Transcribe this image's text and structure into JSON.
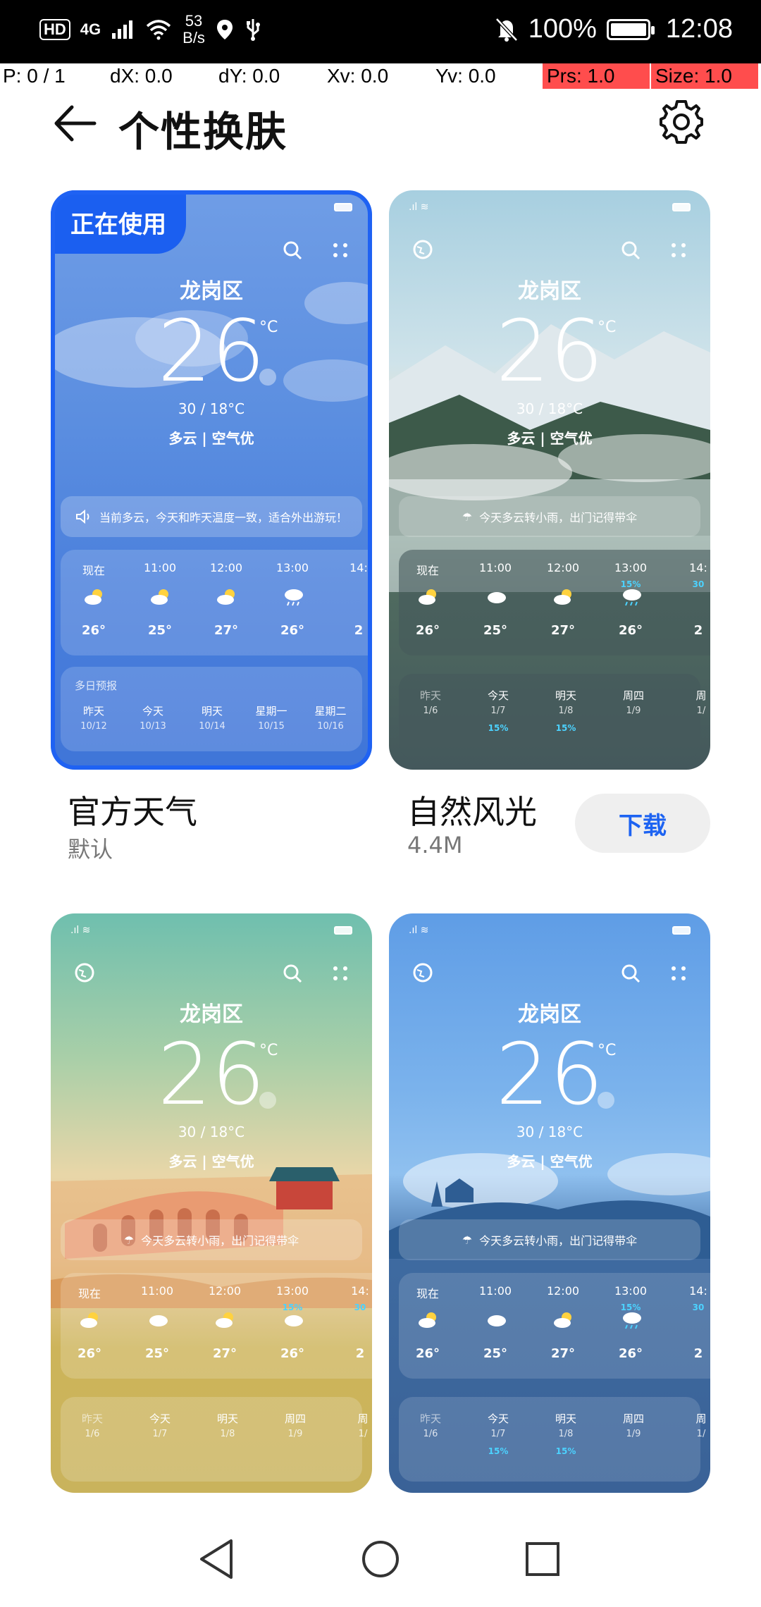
{
  "status_bar": {
    "hd": "HD",
    "network": "4G",
    "speed_value": "53",
    "speed_unit": "B/s",
    "battery": "100%",
    "time": "12:08",
    "icons": [
      "signal-icon",
      "wifi-icon",
      "location-icon",
      "usb-icon",
      "mute-icon",
      "battery-icon"
    ]
  },
  "pointer_info": {
    "p": "P: 0 / 1",
    "dx": "dX: 0.0",
    "dy": "dY: 0.0",
    "xv": "Xv: 0.0",
    "yv": "Yv: 0.0",
    "prs": "Prs: 1.0",
    "size": "Size: 1.0"
  },
  "header": {
    "title": "个性换肤",
    "back_icon": "arrow-left-icon",
    "settings_icon": "gear-icon"
  },
  "themes": [
    {
      "name": "官方天气",
      "meta": "默认",
      "badge": "正在使用",
      "selected": true,
      "colors": {
        "top": "#5b8ee0",
        "bottom": "#3f75d8"
      },
      "preview": {
        "city": "龙岗区",
        "temp": "26",
        "unit": "°C",
        "range": "30 / 18°C",
        "cond": "多云 | 空气优",
        "notice": "当前多云，今天和昨天温度一致，适合外出游玩！",
        "hours": [
          {
            "h": "现在",
            "t": "26°"
          },
          {
            "h": "11:00",
            "t": "25°"
          },
          {
            "h": "12:00",
            "t": "27°"
          },
          {
            "h": "13:00",
            "t": "26°"
          },
          {
            "h": "14:",
            "t": "2"
          }
        ],
        "daily_label": "多日预报",
        "days": [
          {
            "d": "昨天",
            "date": "10/12"
          },
          {
            "d": "今天",
            "date": "10/13"
          },
          {
            "d": "明天",
            "date": "10/14"
          },
          {
            "d": "星期一",
            "date": "10/15"
          },
          {
            "d": "星期二",
            "date": "10/16"
          }
        ]
      }
    },
    {
      "name": "自然风光",
      "meta": "4.4M",
      "action": "下载",
      "selected": false,
      "colors": {
        "top": "#9fc8d8",
        "bottom": "#4a5c5e"
      },
      "preview": {
        "city": "龙岗区",
        "temp": "26",
        "unit": "°C",
        "range": "30 / 18°C",
        "cond": "多云 | 空气优",
        "notice": "今天多云转小雨，出门记得带伞",
        "hours": [
          {
            "h": "现在",
            "t": "26°"
          },
          {
            "h": "11:00",
            "t": "25°"
          },
          {
            "h": "12:00",
            "t": "27°"
          },
          {
            "h": "13:00",
            "t": "26°",
            "p": "15%"
          },
          {
            "h": "14:",
            "t": "2",
            "p": "30"
          }
        ],
        "days": [
          {
            "d": "昨天",
            "date": "1/6"
          },
          {
            "d": "今天",
            "date": "1/7",
            "p": "15%"
          },
          {
            "d": "明天",
            "date": "1/8",
            "p": "15%"
          },
          {
            "d": "周四",
            "date": "1/9"
          },
          {
            "d": "周",
            "date": "1/"
          }
        ]
      }
    },
    {
      "name": "",
      "colors": {
        "top": "#7cc1ad",
        "bottom": "#cdb45a"
      },
      "preview": {
        "city": "龙岗区",
        "temp": "26",
        "unit": "°C",
        "range": "30 / 18°C",
        "cond": "多云 | 空气优",
        "notice": "今天多云转小雨，出门记得带伞",
        "hours": [
          {
            "h": "现在",
            "t": "26°"
          },
          {
            "h": "11:00",
            "t": "25°"
          },
          {
            "h": "12:00",
            "t": "27°"
          },
          {
            "h": "13:00",
            "t": "26°",
            "p": "15%"
          },
          {
            "h": "14:",
            "t": "2",
            "p": "30"
          }
        ],
        "days": [
          {
            "d": "昨天",
            "date": "1/6"
          },
          {
            "d": "今天",
            "date": "1/7"
          },
          {
            "d": "明天",
            "date": "1/8"
          },
          {
            "d": "周四",
            "date": "1/9"
          },
          {
            "d": "周",
            "date": "1/"
          }
        ]
      }
    },
    {
      "name": "",
      "colors": {
        "top": "#6fa7e6",
        "bottom": "#3e6aa0"
      },
      "preview": {
        "city": "龙岗区",
        "temp": "26",
        "unit": "°C",
        "range": "30 / 18°C",
        "cond": "多云 | 空气优",
        "notice": "今天多云转小雨，出门记得带伞",
        "hours": [
          {
            "h": "现在",
            "t": "26°"
          },
          {
            "h": "11:00",
            "t": "25°"
          },
          {
            "h": "12:00",
            "t": "27°"
          },
          {
            "h": "13:00",
            "t": "26°",
            "p": "15%"
          },
          {
            "h": "14:",
            "t": "2",
            "p": "30"
          }
        ],
        "days": [
          {
            "d": "昨天",
            "date": "1/6"
          },
          {
            "d": "今天",
            "date": "1/7",
            "p": "15%"
          },
          {
            "d": "明天",
            "date": "1/8",
            "p": "15%"
          },
          {
            "d": "周四",
            "date": "1/9"
          },
          {
            "d": "周",
            "date": "1/"
          }
        ]
      }
    }
  ],
  "nav": {
    "back": "back-triangle-icon",
    "home": "home-circle-icon",
    "recent": "recent-square-icon"
  }
}
